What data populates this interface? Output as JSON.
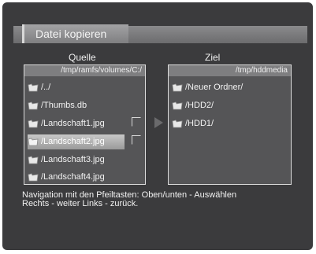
{
  "window": {
    "title": "Datei kopieren"
  },
  "source": {
    "label": "Quelle",
    "path": "/tmp/ramfs/volumes/C:/",
    "items": [
      {
        "label": "/../",
        "icon": "folder-icon",
        "marked": false,
        "selected": false
      },
      {
        "label": "/Thumbs.db",
        "icon": "file-icon",
        "marked": false,
        "selected": false
      },
      {
        "label": "/Landschaft1.jpg",
        "icon": "image-file-icon",
        "marked": true,
        "selected": false
      },
      {
        "label": "/Landschaft2.jpg",
        "icon": "image-file-icon",
        "marked": true,
        "selected": true
      },
      {
        "label": "/Landschaft3.jpg",
        "icon": "image-file-icon",
        "marked": false,
        "selected": false
      },
      {
        "label": "/Landschaft4.jpg",
        "icon": "image-file-icon",
        "marked": false,
        "selected": false
      }
    ]
  },
  "target": {
    "label": "Ziel",
    "path": "/tmp/hddmedia",
    "items": [
      {
        "label": "/Neuer Ordner/",
        "icon": "folder-icon"
      },
      {
        "label": "/HDD2/",
        "icon": "folder-icon"
      },
      {
        "label": "/HDD1/",
        "icon": "folder-icon"
      }
    ]
  },
  "help": {
    "line1": "Navigation mit den Pfeiltasten: Oben/unten - Auswählen",
    "line2": "Rechts - weiter Links - zurück."
  },
  "colors": {
    "background": "#3b3b3d",
    "panel": "#555557",
    "selection": "#b4b4b4",
    "text": "#f2f2f2"
  }
}
